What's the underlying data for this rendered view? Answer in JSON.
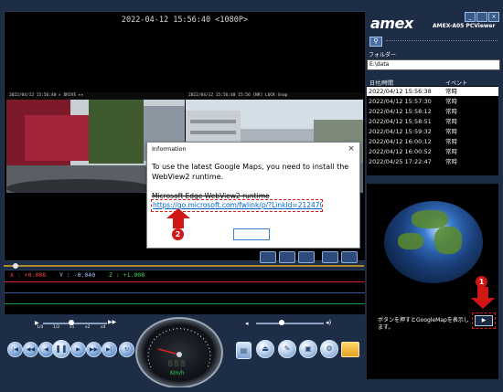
{
  "video": {
    "timestamp": "2022-04-12 15:56:40 <1080P>",
    "cam_left_header": "2022/04/12 15:56:40  ▸ DRIVE  ▸▸",
    "cam_right_header": "2022/04/12 15:56:40  15:56 [NR] LOCK Snap"
  },
  "dialog": {
    "title": "Information",
    "close": "×",
    "message": "To use the latest Google Maps, you need to install the WebView2 runtime.",
    "sub": "Microsoft Edge WebView2 runtime",
    "link": "https://go.microsoft.com/fwlink/p/?LinkId=2124703",
    "ok_label": ""
  },
  "badges": {
    "one": "1",
    "two": "2"
  },
  "graph": {
    "x": "X : +0.088",
    "y": "Y : -0.040",
    "z": "Z : +1.008"
  },
  "speed_labels": [
    "1/4",
    "1/2",
    "x1",
    "x2",
    "x4"
  ],
  "speedometer": {
    "value": "888",
    "unit": "Km/h"
  },
  "app": {
    "logo": "amex",
    "model": "AMEX-A05 PCViewer"
  },
  "window_buttons": {
    "min": "_",
    "close": "×"
  },
  "folder": {
    "label": "フォルダー",
    "value": "E:\\data"
  },
  "events": {
    "col_date": "日付/時間",
    "col_event": "イベント",
    "rows": [
      {
        "date": "2022/04/12 15:56:38",
        "type": "常時",
        "selected": true
      },
      {
        "date": "2022/04/12 15:57:30",
        "type": "常時"
      },
      {
        "date": "2022/04/12 15:58:12",
        "type": "常時"
      },
      {
        "date": "2022/04/12 15:58:51",
        "type": "常時"
      },
      {
        "date": "2022/04/12 15:59:32",
        "type": "常時"
      },
      {
        "date": "2022/04/12 16:00:12",
        "type": "常時"
      },
      {
        "date": "2022/04/12 16:00:52",
        "type": "常時"
      },
      {
        "date": "2022/04/25 17:22:47",
        "type": "常時"
      }
    ]
  },
  "map": {
    "hint": "ボタンを押すとGoogleMapを表示します。",
    "button": "▶"
  },
  "colors": {
    "accent_red": "#e01b1b",
    "panel": "#1d2d45"
  }
}
